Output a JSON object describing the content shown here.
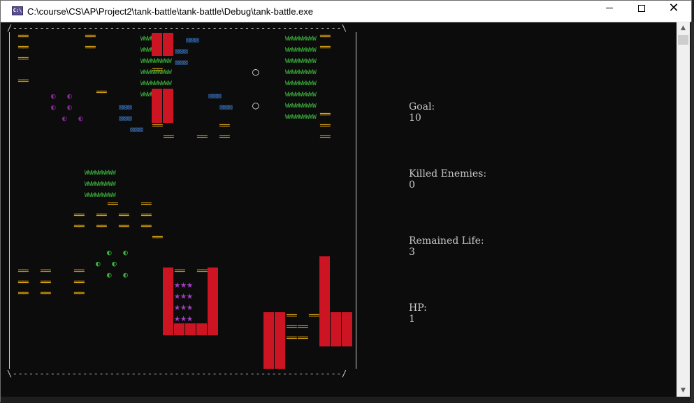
{
  "window": {
    "title": "C:\\course\\CS\\AP\\Project2\\tank-battle\\tank-battle\\Debug\\tank-battle.exe",
    "icon_text": "C:\\",
    "minimize_icon": "minimize-icon",
    "maximize_icon": "maximize-icon",
    "close_glyph": "✕"
  },
  "board": {
    "top_border": "/-------------------------------------------------------------\\",
    "bottom_border": "\\-------------------------------------------------------------/",
    "brick_glyph": "══",
    "grass_glyph": "WWWWWWWWW",
    "water_glyph": "⊠⊠⊠",
    "bullet_glyph": "○",
    "star_glyph": "★★★",
    "enemy_glyph": "◐ ◐",
    "player_glyph": "◐ ◐"
  },
  "status": {
    "goal_label": "Goal:",
    "goal_value": "10",
    "killed_label": "Killed Enemies:",
    "killed_value": "0",
    "life_label": "Remained Life:",
    "life_value": "3",
    "hp_label": "HP:",
    "hp_value": "1"
  },
  "colors": {
    "brick": "#d7a010",
    "steel": "#cc1422",
    "grass": "#3cb43c",
    "water": "#3a78c8",
    "enemy": "#8a2a9a",
    "base_star": "#a040c0",
    "console_bg": "#0c0c0c",
    "console_text": "#c8c8c8"
  },
  "scrollbar": {
    "up_glyph": "▲",
    "down_glyph": "▼"
  }
}
